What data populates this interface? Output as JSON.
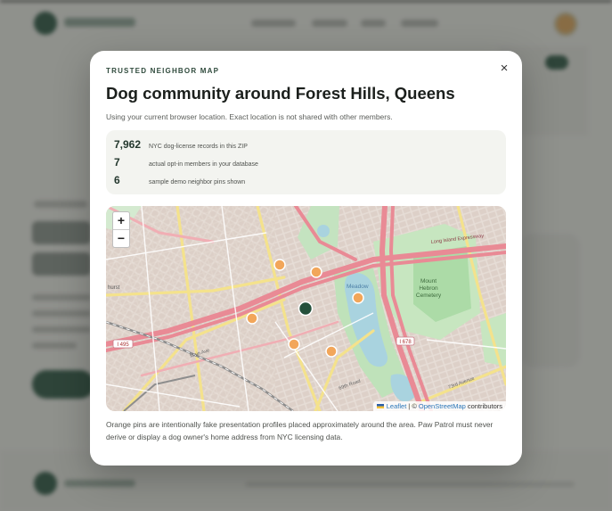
{
  "modal": {
    "eyebrow": "TRUSTED NEIGHBOR MAP",
    "close_glyph": "×",
    "title": "Dog community around Forest Hills, Queens",
    "subtitle": "Using your current browser location. Exact location is not shared with other members.",
    "stats": [
      {
        "value": "7,962",
        "label": "NYC dog-license records in this ZIP"
      },
      {
        "value": "7",
        "label": "actual opt-in members in your database"
      },
      {
        "value": "6",
        "label": "sample demo neighbor pins shown"
      }
    ],
    "footnote": "Orange pins are intentionally fake presentation profiles placed approximately around the area. Paw Patrol must never derive or display a dog owner's home address from NYC licensing data."
  },
  "map": {
    "zoom_in": "+",
    "zoom_out": "−",
    "attribution": {
      "leaflet": "Leaflet",
      "separator": " | © ",
      "osm": "OpenStreetMap",
      "suffix": " contributors"
    },
    "labels": {
      "meadow": "Meadow",
      "mount_hebron": "Mount\nHebron\nCemetery",
      "lie": "Long Island Expressway",
      "rt495": "I 495",
      "rt678": "I 678",
      "main_ave": "Main Ave",
      "rd69": "69th Road",
      "ave73": "73rd Avenue",
      "hurst": "hurst",
      "lie_short": "I 495"
    },
    "colors": {
      "pin_fill": "#f2a65a",
      "pin_stroke": "#ffffff",
      "user_fill": "#24503b",
      "highway": "#e98a95",
      "park": "#b9dfb5",
      "water": "#a9d3df"
    }
  }
}
